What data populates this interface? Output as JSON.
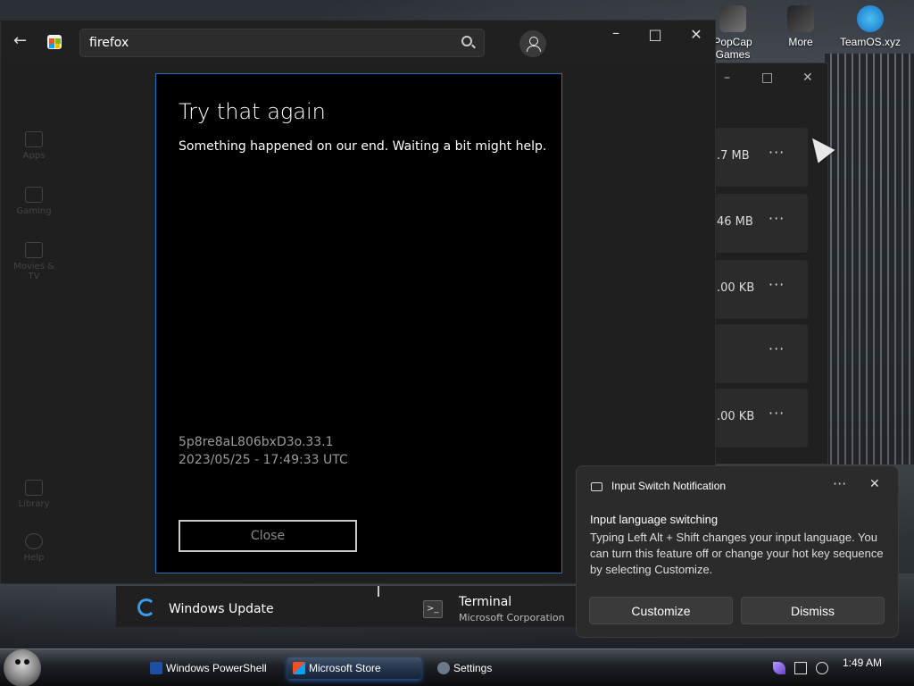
{
  "desktop": {
    "icons": [
      {
        "label": "PopCap\nGames",
        "name": "popcap-games"
      },
      {
        "label": "More",
        "name": "more"
      },
      {
        "label": "TeamOS.xyz",
        "name": "teamos"
      }
    ]
  },
  "bg_window": {
    "rows": [
      {
        "size": ".7 MB"
      },
      {
        "size": "46 MB"
      },
      {
        "size": ".00 KB"
      },
      {
        "size": ""
      },
      {
        "size": ".00 KB"
      }
    ],
    "more_glyph": "···"
  },
  "store": {
    "search_value": "firefox",
    "nav": [
      {
        "label": "Apps"
      },
      {
        "label": "Gaming"
      },
      {
        "label": "Movies & TV"
      },
      {
        "label": "Library"
      },
      {
        "label": "Help"
      }
    ]
  },
  "dialog": {
    "title": "Try that again",
    "message": "Something happened on our end. Waiting a bit might help.",
    "code": "5p8re8aL806bxD3o.33.1",
    "timestamp": "2023/05/25 - 17:49:33 UTC",
    "close_label": "Close"
  },
  "tiles": {
    "windows_update": "Windows Update",
    "terminal_name": "Terminal",
    "terminal_publisher": "Microsoft Corporation"
  },
  "toast": {
    "app": "Input Switch Notification",
    "heading": "Input language switching",
    "body": "Typing Left Alt + Shift changes your input language. You can turn this feature off or change your hot key sequence by selecting Customize.",
    "customize_label": "Customize",
    "dismiss_label": "Dismiss",
    "more_glyph": "···",
    "close_glyph": "✕"
  },
  "taskbar": {
    "items": [
      {
        "label": "Windows PowerShell"
      },
      {
        "label": "Microsoft Store"
      },
      {
        "label": "Settings"
      }
    ],
    "time": "1:49 AM"
  },
  "colors": {
    "accent": "#2b6fb5",
    "windows_update": "#3d9be9"
  }
}
